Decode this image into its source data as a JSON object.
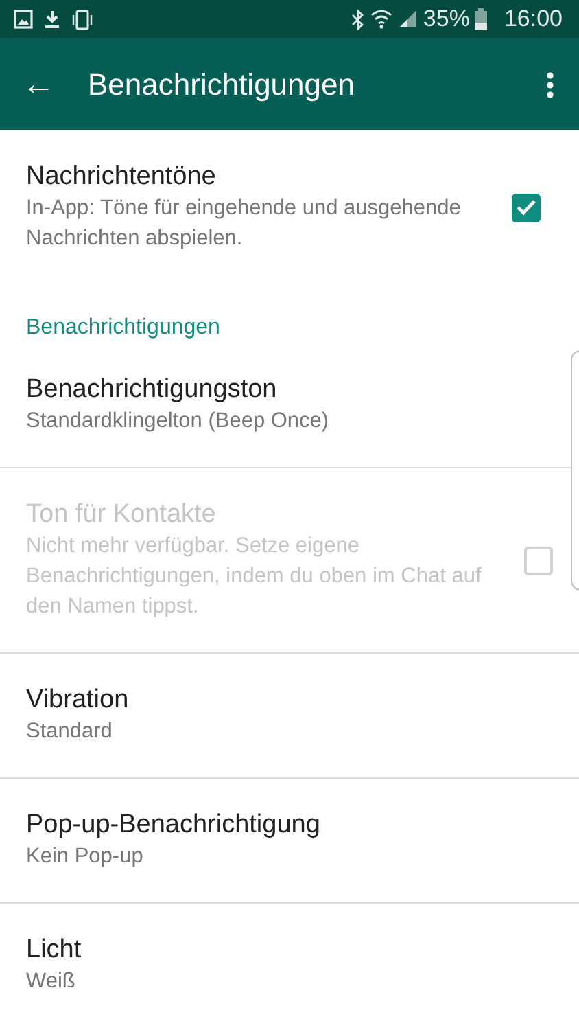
{
  "status_bar": {
    "battery_text": "35%",
    "time": "16:00"
  },
  "app_bar": {
    "back": "←",
    "title": "Benachrichtigungen"
  },
  "items": [
    {
      "kind": "checkbox",
      "title": "Nachrichtentöne",
      "subtitle": "In-App: Töne für eingehende und ausgehende Nachrichten abspielen.",
      "checked": true,
      "disabled": false
    },
    {
      "kind": "header",
      "title": "Benachrichtigungen",
      "disabled": false
    },
    {
      "kind": "option",
      "title": "Benachrichtigungston",
      "subtitle": "Standardklingelton (Beep Once)",
      "disabled": false
    },
    {
      "kind": "checkbox",
      "title": "Ton für Kontakte",
      "subtitle": "Nicht mehr verfügbar. Setze eigene Benachrichtigungen, indem du oben im Chat auf den Namen tippst.",
      "checked": false,
      "disabled": true
    },
    {
      "kind": "option",
      "title": "Vibration",
      "subtitle": "Standard",
      "disabled": false
    },
    {
      "kind": "option",
      "title": "Pop-up-Benachrichtigung",
      "subtitle": "Kein Pop-up",
      "disabled": false
    },
    {
      "kind": "option",
      "title": "Licht",
      "subtitle": "Weiß",
      "disabled": false
    }
  ]
}
